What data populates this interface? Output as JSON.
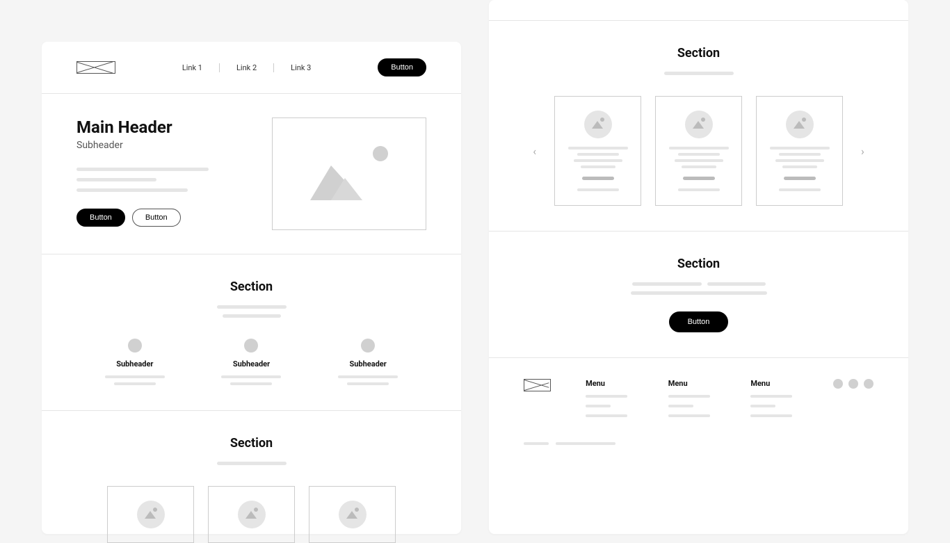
{
  "nav": {
    "links": [
      "Link 1",
      "Link 2",
      "Link 3"
    ],
    "button": "Button"
  },
  "hero": {
    "title": "Main Header",
    "subtitle": "Subheader",
    "button_primary": "Button",
    "button_secondary": "Button"
  },
  "section_features": {
    "title": "Section",
    "items": [
      {
        "title": "Subheader"
      },
      {
        "title": "Subheader"
      },
      {
        "title": "Subheader"
      }
    ]
  },
  "section_cards_left": {
    "title": "Section"
  },
  "section_cards_right": {
    "title": "Section"
  },
  "section_cta": {
    "title": "Section",
    "button": "Button"
  },
  "footer": {
    "menus": [
      {
        "title": "Menu"
      },
      {
        "title": "Menu"
      },
      {
        "title": "Menu"
      }
    ]
  }
}
